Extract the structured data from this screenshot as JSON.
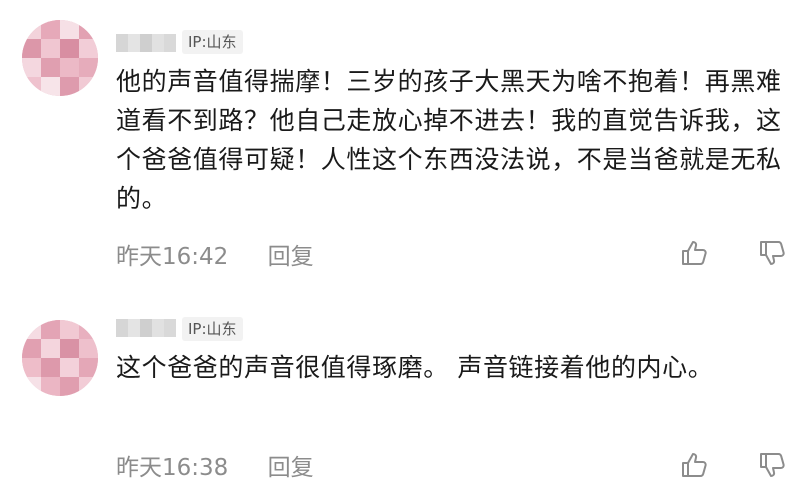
{
  "comments": [
    {
      "ip_label": "IP:山东",
      "text": "他的声音值得揣摩！三岁的孩子大黑天为啥不抱着！再黑难道看不到路？他自己走放心掉不进去！我的直觉告诉我，这个爸爸值得可疑！人性这个东西没法说，不是当爸就是无私的。",
      "time": "昨天16:42",
      "reply_label": "回复",
      "like_icon": "thumbs-up-icon",
      "dislike_icon": "thumbs-down-icon"
    },
    {
      "ip_label": "IP:山东",
      "text": "这个爸爸的声音很值得琢磨。 声音链接着他的内心。",
      "time": "昨天16:38",
      "reply_label": "回复",
      "like_icon": "thumbs-up-icon",
      "dislike_icon": "thumbs-down-icon"
    }
  ],
  "colors": {
    "text": "#1a1a1a",
    "meta": "#8c8c8c",
    "badge_bg": "#f2f2f2",
    "avatar": "#e9b7c4"
  }
}
